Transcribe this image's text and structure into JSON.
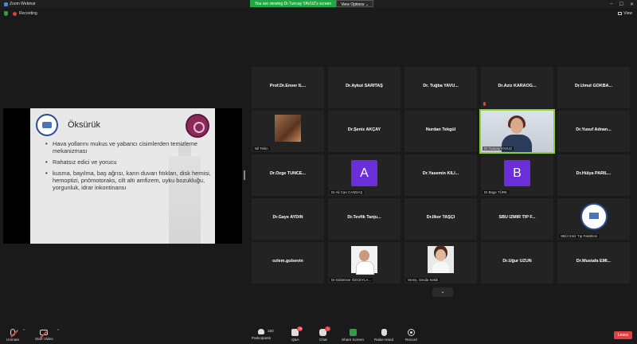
{
  "window": {
    "title": "Zoom Webinar",
    "banner_text": "You are viewing Dr.Tuncay YAVUZ's screen",
    "view_options": "View Options",
    "recording": "Recording",
    "view_label": "View"
  },
  "slide": {
    "title": "Öksürük",
    "bullets": [
      "Hava yollarını mukus ve yabancı cisimlerden temizleme mekanizması",
      "Rahatsız edici ve yorucu",
      "kusma, bayılma, baş ağrısı, karın duvarı fıtıkları, disk hernisi, hemoptizi, pnömotoraks, cilt altı amfizem, uyku bozukluğu, yorgunluk, idrar inkontinansı"
    ]
  },
  "participants": {
    "t1": "Prof.Dr.Enver  İL...",
    "t2": "Dr.Aykut SARITAŞ",
    "t3": "Dr. Tuğba YAVU...",
    "t4": "Dr.Aziz KARAOĞ...",
    "t5": "Dr.Umut GÖKBA...",
    "t6": "Nil Tekin",
    "t7": "Dr.Şeniz AKÇAY",
    "t8": "Nurdan Tekgül",
    "t9": "Dr.Tuncay YAVUZ",
    "t10": "Dr.Yusuf  Adnan...",
    "t11": "Dr.Özge  TUNCE...",
    "t12_letter": "A",
    "t12": "Dr.Ali Can CANDAŞ",
    "t13": "Dr.Yasemin KILI...",
    "t14_letter": "B",
    "t14": "Dr.Büge TÜRK",
    "t15": "Dr.Hülya PARIL...",
    "t16": "Dr.Gaye AYDIN",
    "t17": "Dr.Tevfik Tanju...",
    "t18": "Dr.İlker TAŞÇI",
    "t19": "SBÜ İZMİR TIP F...",
    "t20": "SBÜ İzmir Tıp Fakültesi",
    "t21": "ozlem.gulsevin",
    "t22": "Dr.Gülümser ÖZCEYLA...",
    "t23": "Hemş. Sevda Kekik",
    "t24": "Dr.Uğur UZUN",
    "t25": "Dr.Mustafa  EMİ..."
  },
  "toolbar": {
    "unmute": "Unmute",
    "start_video": "Start Video",
    "participants": "Participants",
    "participants_count": "150",
    "qa": "Q&A",
    "qa_badge": "26",
    "chat": "Chat",
    "chat_badge": "1",
    "share": "Share Screen",
    "raise_hand": "Raise Hand",
    "record": "Record",
    "leave": "Leave"
  },
  "colors": {
    "accent": "#2d8cff",
    "banner": "#23a745",
    "leave": "#e04040",
    "avatar": "#6a2fd6",
    "active_speaker": "#8fcf3a"
  }
}
